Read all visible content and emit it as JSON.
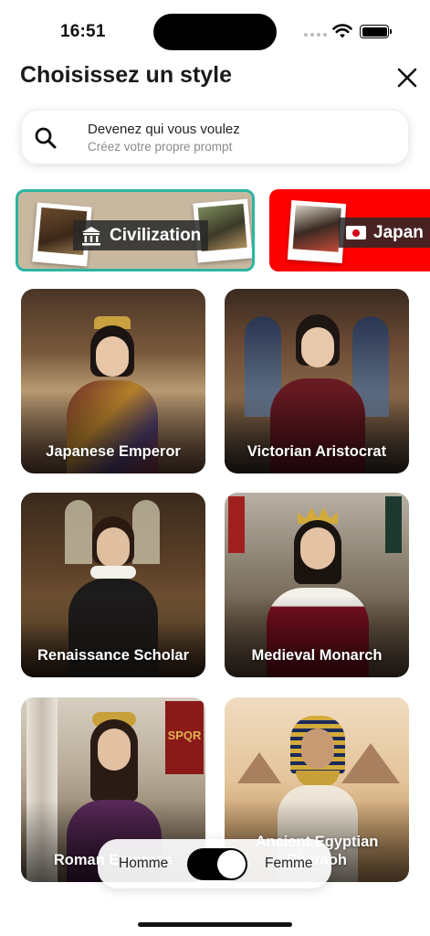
{
  "status_bar": {
    "time": "16:51",
    "icons": [
      "signal-icon",
      "wifi-icon",
      "battery-icon"
    ]
  },
  "header": {
    "title": "Choisissez un style",
    "close_icon": "close-icon"
  },
  "search": {
    "icon": "search-icon",
    "primary": "Devenez qui vous voulez",
    "secondary": "Créez votre propre prompt"
  },
  "categories": [
    {
      "label": "Civilization",
      "icon": "temple-icon",
      "color": "#c9b8a0",
      "border": "#2cb5a0",
      "selected": true
    },
    {
      "label": "Japan",
      "icon": "japan-flag-icon",
      "color": "#ff0000",
      "selected": false
    }
  ],
  "styles": [
    {
      "label": "Japanese Emperor"
    },
    {
      "label": "Victorian Aristocrat"
    },
    {
      "label": "Renaissance Scholar"
    },
    {
      "label": "Medieval Monarch"
    },
    {
      "label": "Roman Empress"
    },
    {
      "label": "Ancient Egyptian Pharaoh"
    }
  ],
  "gender_toggle": {
    "left_label": "Homme",
    "right_label": "Femme",
    "selected": "Femme"
  },
  "colors": {
    "accent": "#2cb5a0",
    "japan_red": "#ff0000",
    "toggle": "#000000"
  }
}
